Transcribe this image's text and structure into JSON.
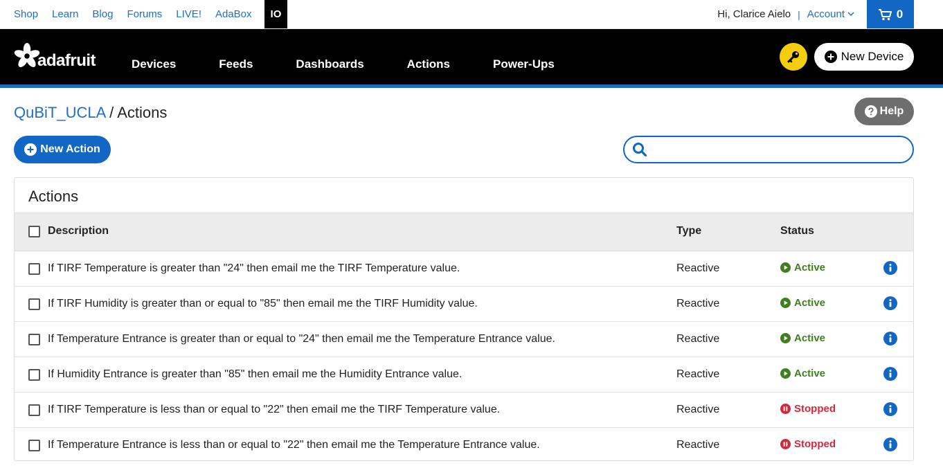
{
  "topbar": {
    "links": [
      "Shop",
      "Learn",
      "Blog",
      "Forums",
      "LIVE!",
      "AdaBox"
    ],
    "io": "IO",
    "greeting": "Hi, Clarice Aielo",
    "separator": "|",
    "account": "Account",
    "cart_count": "0"
  },
  "mainnav": {
    "logo_text": "adafruit",
    "links": [
      "Devices",
      "Feeds",
      "Dashboards",
      "Actions",
      "Power-Ups"
    ],
    "new_device": "New Device"
  },
  "page": {
    "breadcrumb_parent": "QuBiT_UCLA",
    "breadcrumb_sep": " / ",
    "breadcrumb_current": "Actions",
    "help": "Help",
    "new_action": "New Action",
    "search_placeholder": ""
  },
  "panel": {
    "title": "Actions",
    "columns": {
      "description": "Description",
      "type": "Type",
      "status": "Status"
    },
    "rows": [
      {
        "description": "If TIRF Temperature is greater than \"24\" then email me the TIRF Temperature value.",
        "type": "Reactive",
        "status": "Active"
      },
      {
        "description": "If TIRF Humidity is greater than or equal to \"85\" then email me the TIRF Humidity value.",
        "type": "Reactive",
        "status": "Active"
      },
      {
        "description": "If Temperature Entrance is greater than or equal to \"24\" then email me the Temperature Entrance value.",
        "type": "Reactive",
        "status": "Active"
      },
      {
        "description": "If Humidity Entrance is greater than \"85\" then email me the Humidity Entrance value.",
        "type": "Reactive",
        "status": "Active"
      },
      {
        "description": "If TIRF Temperature is less than or equal to \"22\" then email me the TIRF Temperature value.",
        "type": "Reactive",
        "status": "Stopped"
      },
      {
        "description": "If Temperature Entrance is less than or equal to \"22\" then email me the Temperature Entrance value.",
        "type": "Reactive",
        "status": "Stopped"
      }
    ]
  },
  "colors": {
    "accent_blue": "#1267c4",
    "active_green": "#3f7f1f",
    "stopped_red": "#d3283c",
    "key_yellow": "#f5cd0f"
  }
}
